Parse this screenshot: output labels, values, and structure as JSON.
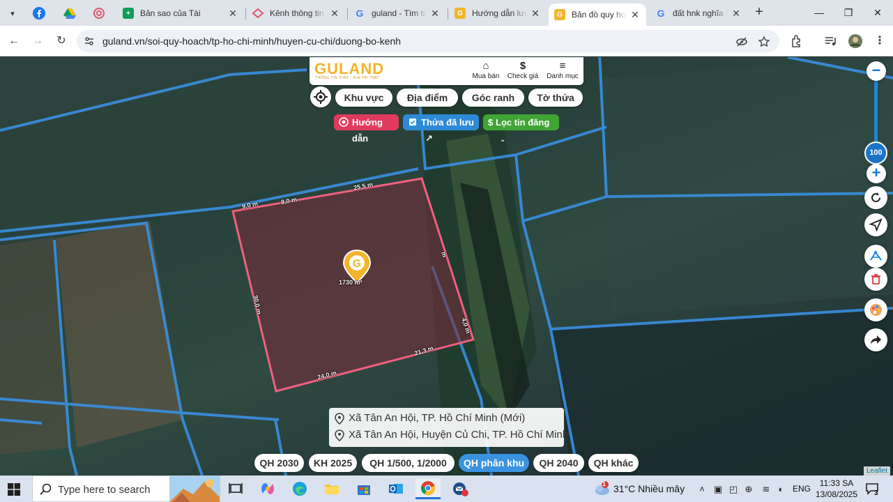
{
  "browser": {
    "tabs": [
      {
        "title": "Bản sao của Tài",
        "icon": "sheets-icon",
        "color": "#0f9d58",
        "active": false
      },
      {
        "title": "Kênh thông tin",
        "icon": "channel-icon",
        "color": "#e0566b",
        "active": false
      },
      {
        "title": "guland - Tìm trê",
        "icon": "google-icon",
        "color": "#4285f4",
        "active": false
      },
      {
        "title": "Hướng dẫn lưu",
        "icon": "guland-icon",
        "color": "#f2b42a",
        "active": false
      },
      {
        "title": "Bản đồ quy hoạ",
        "icon": "guland-icon",
        "color": "#f2b42a",
        "active": true
      },
      {
        "title": "đất hnk nghĩa là",
        "icon": "google-icon",
        "color": "#4285f4",
        "active": false
      }
    ],
    "url": "guland.vn/soi-quy-hoach/tp-ho-chi-minh/huyen-cu-chi/duong-bo-kenh"
  },
  "app": {
    "logo": "GULAND",
    "logo_tagline": "THÔNG TIN THẬT - GIÁ TRỊ THẬT",
    "menu": [
      {
        "label": "Mua bán",
        "icon": "house-icon"
      },
      {
        "label": "Check giá",
        "icon": "dollar-icon"
      },
      {
        "label": "Danh mục",
        "icon": "menu-icon"
      }
    ],
    "search_tabs": [
      "Khu vực",
      "Địa điểm",
      "Góc ranh",
      "Tờ thửa"
    ],
    "chips": {
      "guide": "Hướng dẫn",
      "saved": "Thửa đã lưu",
      "filter": "Lọc tin đăng",
      "guide_color": "#e03b5e",
      "saved_color": "#2d8ad6",
      "filter_color": "#3fa535"
    },
    "parcel": {
      "edges": [
        "9,0 m",
        "8,0 m",
        "25,5 m",
        "m",
        "4,0 m",
        "21,3 m",
        "24,0 m",
        "30,0 m"
      ],
      "area": "1730 m²",
      "outline_color": "#f0607e"
    },
    "zoom_level": "100",
    "address": {
      "line1": "Xã Tân An Hội, TP. Hồ Chí Minh (Mới)",
      "line2": "Xã Tân An Hội, Huyện Củ Chi, TP. Hồ Chí Minh"
    },
    "plan_layers": [
      {
        "label": "QH 2030",
        "active": false
      },
      {
        "label": "KH 2025",
        "active": false
      },
      {
        "label": "QH 1/500, 1/2000",
        "active": false
      },
      {
        "label": "QH phân khu",
        "active": true
      },
      {
        "label": "QH 2040",
        "active": false
      },
      {
        "label": "QH khác",
        "active": false
      }
    ],
    "attribution": "Leaflet"
  },
  "taskbar": {
    "search_placeholder": "Type here to search",
    "weather": "31°C  Nhiều mây",
    "weather_badge": "1",
    "language": "ENG",
    "time": "11:33 SA",
    "date": "13/08/2025",
    "notifications": "3"
  }
}
